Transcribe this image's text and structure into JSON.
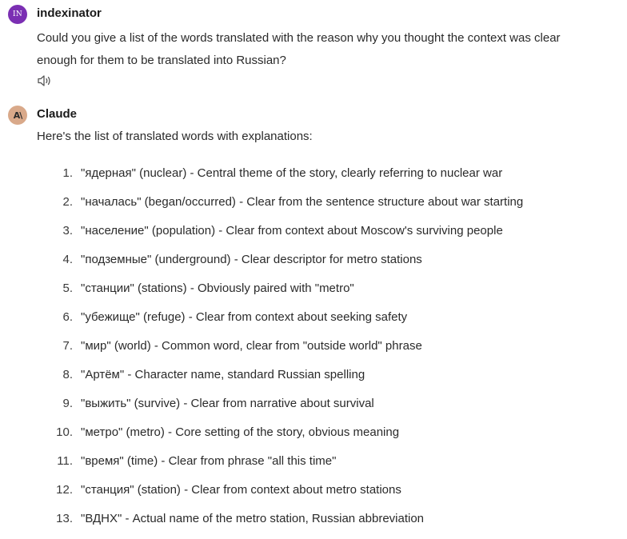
{
  "user_message": {
    "avatar_initials": "IN",
    "name": "indexinator",
    "text": "Could you give a list of the words translated with the reason why you thought the context was clear enough for them to be translated into Russian?",
    "speaker_icon": "speaker-icon"
  },
  "assistant_message": {
    "avatar_glyph": "A\\",
    "name": "Claude",
    "intro": "Here's the list of translated words with explanations:",
    "items": [
      {
        "num": "1.",
        "text": "\"ядерная\" (nuclear) - Central theme of the story, clearly referring to nuclear war"
      },
      {
        "num": "2.",
        "text": "\"началась\" (began/occurred) - Clear from the sentence structure about war starting"
      },
      {
        "num": "3.",
        "text": "\"население\" (population) - Clear from context about Moscow's surviving people"
      },
      {
        "num": "4.",
        "text": "\"подземные\" (underground) - Clear descriptor for metro stations"
      },
      {
        "num": "5.",
        "text": "\"станции\" (stations) - Obviously paired with \"metro\""
      },
      {
        "num": "6.",
        "text": "\"убежище\" (refuge) - Clear from context about seeking safety"
      },
      {
        "num": "7.",
        "text": "\"мир\" (world) - Common word, clear from \"outside world\" phrase"
      },
      {
        "num": "8.",
        "text": "\"Артём\" - Character name, standard Russian spelling"
      },
      {
        "num": "9.",
        "text": "\"выжить\" (survive) - Clear from narrative about survival"
      },
      {
        "num": "10.",
        "text": "\"метро\" (metro) - Core setting of the story, obvious meaning"
      },
      {
        "num": "11.",
        "text": "\"время\" (time) - Clear from phrase \"all this time\""
      },
      {
        "num": "12.",
        "text": "\"станция\" (station) - Clear from context about metro stations"
      },
      {
        "num": "13.",
        "text": "\"ВДНХ\" - Actual name of the metro station, Russian abbreviation"
      }
    ]
  },
  "colors": {
    "user_avatar": "#7b2fb3",
    "claude_avatar": "#d9a98a",
    "text": "#2a2a2a"
  }
}
